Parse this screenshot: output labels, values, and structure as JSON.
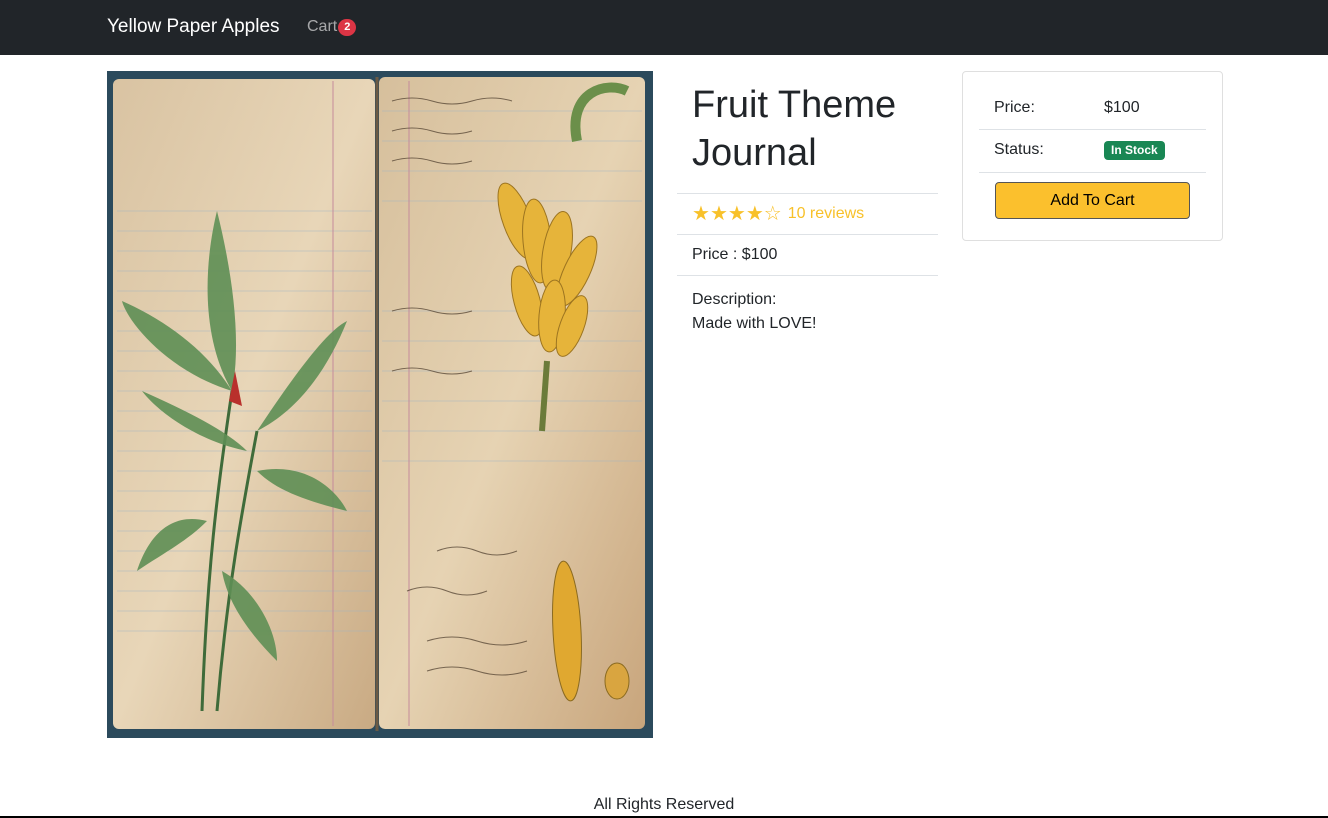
{
  "nav": {
    "brand": "Yellow Paper Apples",
    "cart_label": "Cart",
    "cart_count": "2"
  },
  "product": {
    "title": "Fruit Theme Journal",
    "rating": 4,
    "rating_max": 5,
    "reviews_text": "10 reviews",
    "price_line": "Price : $100",
    "description_label": "Description:",
    "description_text": "Made with LOVE!"
  },
  "purchase": {
    "price_label": "Price:",
    "price_value": "$100",
    "status_label": "Status:",
    "status_value": "In Stock",
    "add_to_cart_label": "Add To Cart"
  },
  "footer": {
    "text": "All Rights Reserved"
  },
  "colors": {
    "navbar": "#212529",
    "badge_red": "#dc3545",
    "star_yellow": "#f8c12a",
    "stock_green": "#198754",
    "button_yellow": "#fbc02d"
  },
  "icons": {
    "star_full": "★",
    "star_empty": "☆"
  }
}
